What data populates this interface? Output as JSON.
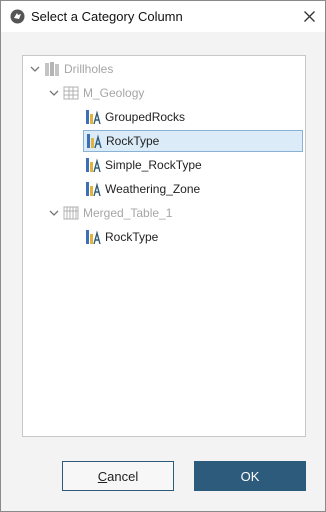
{
  "window": {
    "title": "Select a Category Column"
  },
  "tree": {
    "root": {
      "label": "Drillholes",
      "icon": "drillholes-icon"
    },
    "groups": [
      {
        "label": "M_Geology",
        "icon": "table-icon",
        "items": [
          {
            "label": "GroupedRocks",
            "icon": "category-column-icon"
          },
          {
            "label": "RockType",
            "icon": "category-column-icon",
            "selected": true
          },
          {
            "label": "Simple_RockType",
            "icon": "category-column-icon"
          },
          {
            "label": "Weathering_Zone",
            "icon": "category-column-icon"
          }
        ]
      },
      {
        "label": "Merged_Table_1",
        "icon": "merged-table-icon",
        "items": [
          {
            "label": "RockType",
            "icon": "category-column-icon"
          }
        ]
      }
    ]
  },
  "buttons": {
    "cancel": {
      "first": "C",
      "rest": "ancel"
    },
    "ok": "OK"
  },
  "colors": {
    "accent": "#2d5b7c",
    "selection": "#dcebf8",
    "disabled_text": "#a6a6a6"
  }
}
